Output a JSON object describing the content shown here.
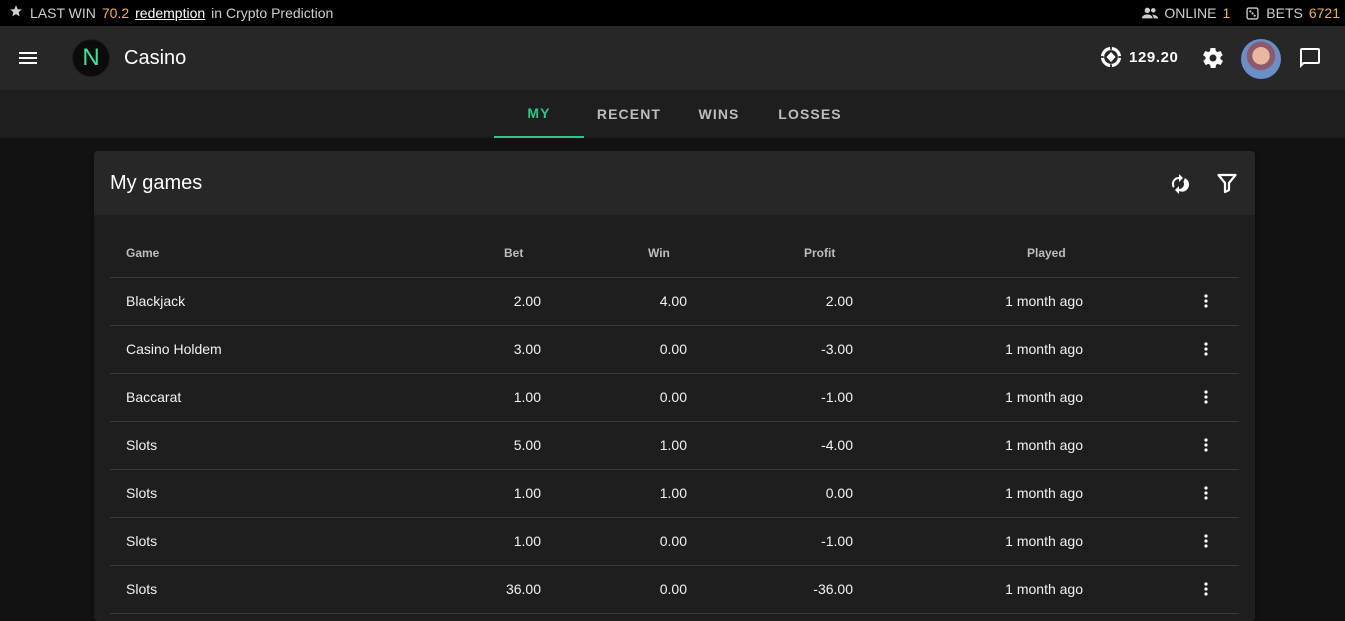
{
  "ticker": {
    "label": "LAST WIN",
    "amount": "70.2",
    "user": "redemption",
    "context": "in Crypto Prediction",
    "online_label": "ONLINE",
    "online_count": "1",
    "bets_label": "BETS",
    "bets_count": "6721"
  },
  "appbar": {
    "title": "Casino",
    "logo_letter": "N",
    "balance": "129.20"
  },
  "tabs": [
    {
      "label": "MY",
      "active": true
    },
    {
      "label": "RECENT",
      "active": false
    },
    {
      "label": "WINS",
      "active": false
    },
    {
      "label": "LOSSES",
      "active": false
    }
  ],
  "card": {
    "title": "My games"
  },
  "table": {
    "headers": {
      "game": "Game",
      "bet": "Bet",
      "win": "Win",
      "profit": "Profit",
      "played": "Played"
    },
    "rows": [
      {
        "game": "Blackjack",
        "bet": "2.00",
        "win": "4.00",
        "profit": "2.00",
        "played": "1 month ago"
      },
      {
        "game": "Casino Holdem",
        "bet": "3.00",
        "win": "0.00",
        "profit": "-3.00",
        "played": "1 month ago"
      },
      {
        "game": "Baccarat",
        "bet": "1.00",
        "win": "0.00",
        "profit": "-1.00",
        "played": "1 month ago"
      },
      {
        "game": "Slots",
        "bet": "5.00",
        "win": "1.00",
        "profit": "-4.00",
        "played": "1 month ago"
      },
      {
        "game": "Slots",
        "bet": "1.00",
        "win": "1.00",
        "profit": "0.00",
        "played": "1 month ago"
      },
      {
        "game": "Slots",
        "bet": "1.00",
        "win": "0.00",
        "profit": "-1.00",
        "played": "1 month ago"
      },
      {
        "game": "Slots",
        "bet": "36.00",
        "win": "0.00",
        "profit": "-36.00",
        "played": "1 month ago"
      }
    ]
  },
  "colors": {
    "accent": "#2ec589",
    "amount": "#f0b44b",
    "appbar": "#272727",
    "background": "#121212"
  }
}
